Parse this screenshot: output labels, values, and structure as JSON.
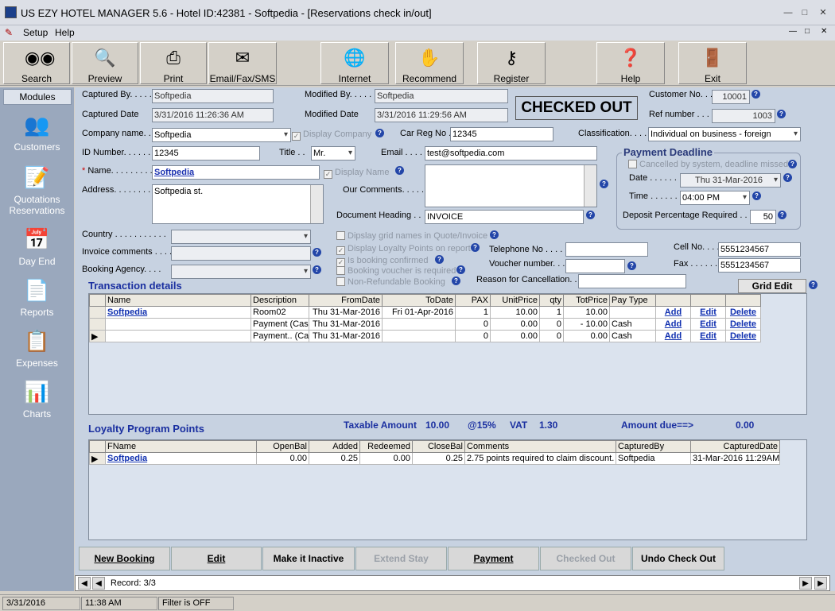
{
  "window": {
    "title": "US EZY HOTEL MANAGER 5.6 - Hotel ID:42381 - Softpedia - [Reservations check in/out]"
  },
  "menu": {
    "setup": "Setup",
    "help": "Help"
  },
  "toolbar": {
    "search": "Search",
    "preview": "Preview",
    "print": "Print",
    "email_fax_sms": "Email/Fax/SMS",
    "internet": "Internet",
    "recommend": "Recommend",
    "register": "Register",
    "help": "Help",
    "exit": "Exit"
  },
  "sidebar": {
    "heading": "Modules",
    "customers": "Customers",
    "quotations": "Quotations",
    "reservations": "Reservations",
    "day_end": "Day End",
    "reports": "Reports",
    "expenses": "Expenses",
    "charts": "Charts"
  },
  "form": {
    "captured_by_label": "Captured By. . . . .",
    "captured_by": "Softpedia",
    "captured_date_label": "Captured Date",
    "captured_date": "3/31/2016 11:26:36 AM",
    "modified_by_label": "Modified By. . . . .",
    "modified_by": "Softpedia",
    "modified_date_label": "Modified Date",
    "modified_date": "3/31/2016 11:29:56 AM",
    "status_stamp": "CHECKED OUT",
    "customer_no_label": "Customer No. . .",
    "customer_no": "10001",
    "ref_number_label": "Ref number . . .",
    "ref_number": "1003",
    "company_name_label": "Company name. .",
    "company_name": "Softpedia",
    "display_company_label": "Display Company",
    "car_reg_label": "Car Reg No .",
    "car_reg": "12345",
    "classification_label": "Classification. . . .",
    "classification": "Individual on business - foreign",
    "id_number_label": "ID Number. . . . . .",
    "id_number": "12345",
    "title_label": "Title . .",
    "title": "Mr.",
    "email_label": "Email . . . . .",
    "email": "test@softpedia.com",
    "name_label": "Name. . . . . . . . .",
    "name": "Softpedia",
    "display_name_label": "Display Name",
    "address_label": "Address. . . . . . . .",
    "address": "Softpedia st.",
    "our_comments_label": "Our Comments. . . . .",
    "our_comments": "",
    "document_heading_label": "Document Heading . .",
    "document_heading": "INVOICE",
    "country_label": "Country . . . . . . . . . . .",
    "country": "",
    "invoice_comments_label": "Invoice comments . . . .",
    "invoice_comments": "",
    "booking_agency_label": "Booking Agency. . . .",
    "booking_agency": "",
    "opt_grid_names": "Dipslay grid names in Quote/Invoice",
    "opt_loyalty": "Display Loyalty Points on report",
    "opt_booking_confirmed": "Is booking confirmed",
    "opt_voucher_required": "Booking voucher is required",
    "opt_non_refundable": "Non-Refundable Booking",
    "telephone_label": "Telephone No . . . .",
    "telephone": "",
    "voucher_label": "Voucher number. . .",
    "voucher": "",
    "reason_label": "Reason for Cancellation. . . .",
    "reason": "",
    "cell_label": "Cell No. . . .",
    "cell": "5551234567",
    "fax_label": "Fax . . . . . .",
    "fax": "5551234567"
  },
  "payment_deadline": {
    "title": "Payment Deadline",
    "cancelled_label": "Cancelled by system, deadline missed",
    "date_label": "Date . . . . . .",
    "date": "Thu 31-Mar-2016",
    "time_label": "Time . . . . . . .",
    "time": "04:00 PM",
    "deposit_label": "Deposit Percentage Required . .",
    "deposit": "50"
  },
  "transactions": {
    "title": "Transaction details",
    "grid_edit": "Grid Edit",
    "columns": [
      "Name",
      "Description",
      "FromDate",
      "ToDate",
      "PAX",
      "UnitPrice",
      "qty",
      "TotPrice",
      "Pay Type",
      "",
      "",
      ""
    ],
    "rows": [
      [
        "Softpedia",
        "Room02",
        "Thu 31-Mar-2016",
        "Fri 01-Apr-2016",
        "1",
        "10.00",
        "1",
        "10.00",
        "",
        "Add",
        "Edit",
        "Delete"
      ],
      [
        "",
        "Payment (Cash",
        "Thu 31-Mar-2016",
        "",
        "0",
        "0.00",
        "0",
        "- 10.00",
        "Cash",
        "Add",
        "Edit",
        "Delete"
      ],
      [
        "",
        "Payment.. (Cas",
        "Thu 31-Mar-2016",
        "",
        "0",
        "0.00",
        "0",
        "0.00",
        "Cash",
        "Add",
        "Edit",
        "Delete"
      ]
    ]
  },
  "totals": {
    "taxable_label": "Taxable Amount",
    "taxable": "10.00",
    "vat_rate": "@15%",
    "vat_label": "VAT",
    "vat": "1.30",
    "due_label": "Amount due==>",
    "due": "0.00"
  },
  "loyalty": {
    "title": "Loyalty Program Points",
    "columns": [
      "FName",
      "OpenBal",
      "Added",
      "Redeemed",
      "CloseBal",
      "Comments",
      "CapturedBy",
      "CapturedDate"
    ],
    "rows": [
      [
        "Softpedia",
        "0.00",
        "0.25",
        "0.00",
        "0.25",
        "2.75 points required to claim discount.",
        "Softpedia",
        "31-Mar-2016 11:29AM"
      ]
    ]
  },
  "actions": {
    "new_booking": "New Booking",
    "edit": "Edit",
    "make_inactive": "Make it Inactive",
    "extend_stay": "Extend Stay",
    "payment": "Payment",
    "checked_out": "Checked Out",
    "undo_check_out": "Undo Check Out"
  },
  "navigator": {
    "record": "Record: 3/3"
  },
  "status": {
    "date": "3/31/2016",
    "time": "11:38 AM",
    "filter": "Filter is OFF"
  }
}
